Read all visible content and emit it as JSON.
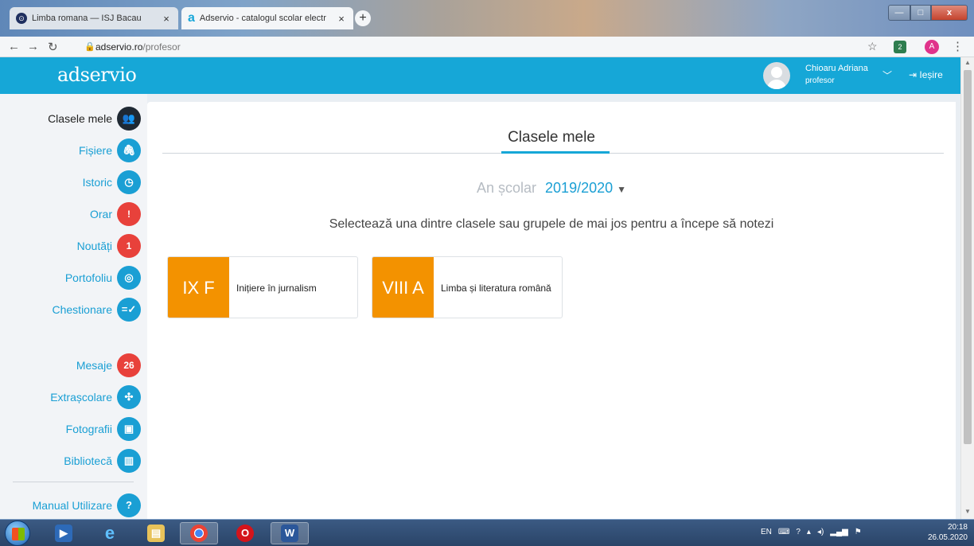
{
  "browser": {
    "tabs": [
      {
        "title": "Limba romana — ISJ Bacau",
        "icon": "globe-icon"
      },
      {
        "title": "Adservio - catalogul scolar electr",
        "icon": "adservio-a-icon"
      }
    ],
    "new_tab": "+",
    "close_glyph": "×",
    "window_controls": {
      "minimize": "—",
      "maximize": "□",
      "close": "x"
    },
    "url_host": "adservio.ro",
    "url_path": "/profesor",
    "profile_initial": "A",
    "extension_badge": "2"
  },
  "header": {
    "logo": "adservio",
    "user_name": "Chioaru Adriana",
    "user_role": "profesor",
    "logout": "Ieșire"
  },
  "sidebar": {
    "items": [
      {
        "label": "Clasele mele",
        "icon": "group-icon",
        "glyph": "👥",
        "badge": ""
      },
      {
        "label": "Fișiere",
        "icon": "paperclip-icon",
        "glyph": "🖇",
        "badge": ""
      },
      {
        "label": "Istoric",
        "icon": "history-clock-icon",
        "glyph": "◷",
        "badge": ""
      },
      {
        "label": "Orar",
        "icon": "alert-badge-icon",
        "glyph": "!",
        "badge": "!"
      },
      {
        "label": "Noutăți",
        "icon": "count-badge-icon",
        "glyph": "1",
        "badge": "1"
      },
      {
        "label": "Portofoliu",
        "icon": "portfolio-icon",
        "glyph": "◎",
        "badge": ""
      },
      {
        "label": "Chestionare",
        "icon": "checklist-icon",
        "glyph": "=✓",
        "badge": ""
      },
      {
        "label": "Mesaje",
        "icon": "messages-count-icon",
        "glyph": "26",
        "badge": "26"
      },
      {
        "label": "Extrașcolare",
        "icon": "activities-icon",
        "glyph": "✣",
        "badge": ""
      },
      {
        "label": "Fotografii",
        "icon": "photos-icon",
        "glyph": "▣",
        "badge": ""
      },
      {
        "label": "Bibliotecă",
        "icon": "books-icon",
        "glyph": "▥",
        "badge": ""
      },
      {
        "label": "Manual Utilizare",
        "icon": "help-icon",
        "glyph": "?",
        "badge": ""
      }
    ]
  },
  "main": {
    "title": "Clasele mele",
    "school_year_label": "An școlar",
    "school_year_value": "2019/2020",
    "caret": "▼",
    "instructions": "Selectează una dintre clasele sau grupele de mai jos pentru a începe să notezi",
    "classes": [
      {
        "code": "IX F",
        "subject": "Inițiere în jurnalism"
      },
      {
        "code": "VIII A",
        "subject": "Limba și literatura română"
      }
    ]
  },
  "taskbar": {
    "tray_lang": "EN",
    "time": "20:18",
    "date": "26.05.2020"
  },
  "colors": {
    "accent": "#16a7d7",
    "class_tile": "#f39200",
    "badge_red": "#e8413b"
  }
}
